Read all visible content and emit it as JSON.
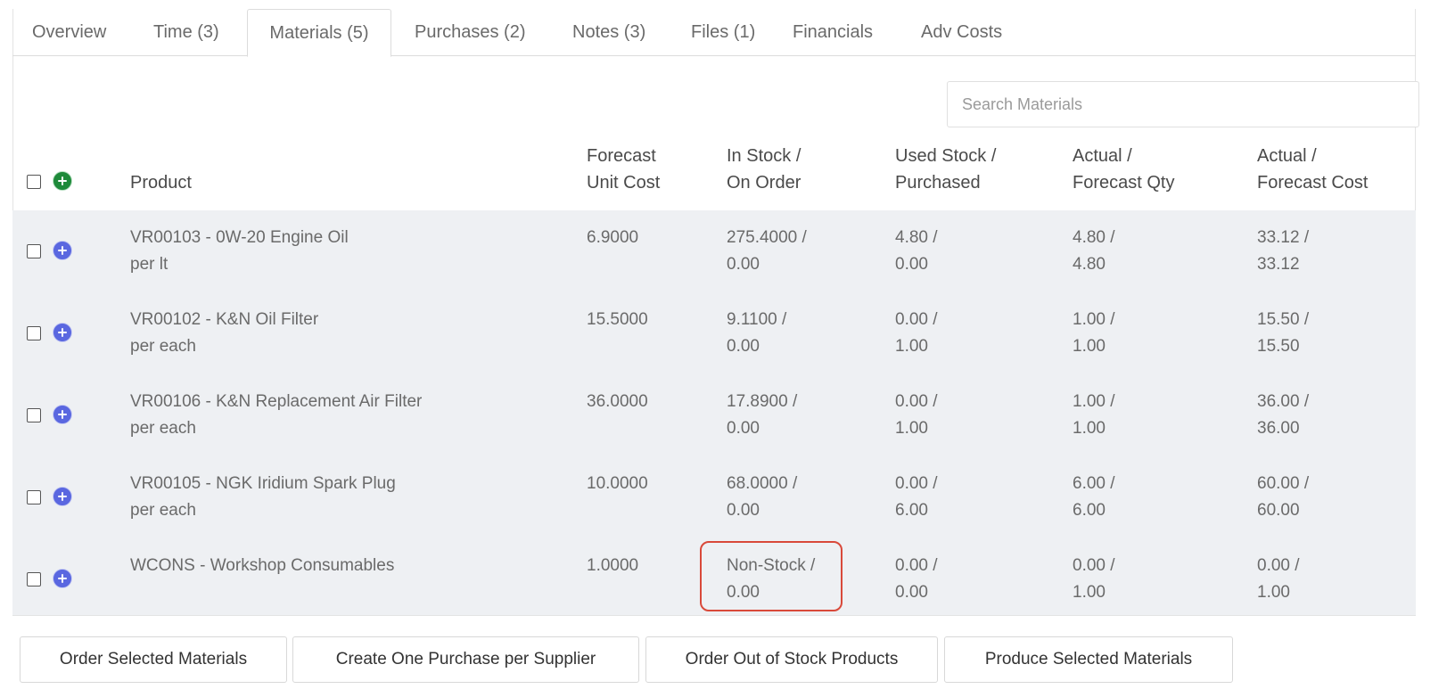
{
  "tabs": [
    {
      "label": "Overview"
    },
    {
      "label": "Time (3)"
    },
    {
      "label": "Materials (5)"
    },
    {
      "label": "Purchases (2)"
    },
    {
      "label": "Notes (3)"
    },
    {
      "label": "Files (1)"
    },
    {
      "label": "Financials"
    },
    {
      "label": "Adv Costs"
    }
  ],
  "active_tab": "Materials (5)",
  "search": {
    "placeholder": "Search Materials",
    "value": ""
  },
  "columns": {
    "product": "Product",
    "forecast_unit_cost": [
      "Forecast",
      "Unit Cost"
    ],
    "in_stock": [
      "In Stock /",
      "On Order"
    ],
    "used_stock": [
      "Used Stock /",
      "Purchased"
    ],
    "actual_qty": [
      "Actual /",
      "Forecast Qty"
    ],
    "actual_cost": [
      "Actual /",
      "Forecast Cost"
    ]
  },
  "rows": [
    {
      "name": "VR00103 - 0W-20 Engine Oil",
      "unit": "per lt",
      "cost": "6.9000",
      "in_stock": "275.4000 /",
      "on_order": "0.00",
      "used": "4.80 /",
      "purchased": "0.00",
      "actual_qty": "4.80 /",
      "forecast_qty": "4.80",
      "actual_cost": "33.12 /",
      "forecast_cost": "33.12"
    },
    {
      "name": "VR00102 - K&N Oil Filter",
      "unit": "per each",
      "cost": "15.5000",
      "in_stock": "9.1100 /",
      "on_order": "0.00",
      "used": "0.00 /",
      "purchased": "1.00",
      "actual_qty": "1.00 /",
      "forecast_qty": "1.00",
      "actual_cost": "15.50 /",
      "forecast_cost": "15.50"
    },
    {
      "name": "VR00106 - K&N Replacement Air Filter",
      "unit": "per each",
      "cost": "36.0000",
      "in_stock": "17.8900 /",
      "on_order": "0.00",
      "used": "0.00 /",
      "purchased": "1.00",
      "actual_qty": "1.00 /",
      "forecast_qty": "1.00",
      "actual_cost": "36.00 /",
      "forecast_cost": "36.00"
    },
    {
      "name": "VR00105 - NGK Iridium Spark Plug",
      "unit": "per each",
      "cost": "10.0000",
      "in_stock": "68.0000 /",
      "on_order": "0.00",
      "used": "0.00 /",
      "purchased": "6.00",
      "actual_qty": "6.00 /",
      "forecast_qty": "6.00",
      "actual_cost": "60.00 /",
      "forecast_cost": "60.00"
    },
    {
      "name": "WCONS - Workshop Consumables",
      "unit": "",
      "cost": "1.0000",
      "in_stock": "Non-Stock /",
      "on_order": "0.00",
      "used": "0.00 /",
      "purchased": "0.00",
      "actual_qty": "0.00 /",
      "forecast_qty": "1.00",
      "actual_cost": "0.00 /",
      "forecast_cost": "1.00"
    }
  ],
  "buttons": {
    "order_selected": "Order Selected Materials",
    "one_purchase": "Create One Purchase per Supplier",
    "order_out_of_stock": "Order Out of Stock Products",
    "produce_selected": "Produce Selected Materials"
  },
  "colors": {
    "add_all": "#1e8a3a",
    "add_row": "#5a67e0",
    "highlight": "#d9493a",
    "row_background": "#eef0f3"
  }
}
